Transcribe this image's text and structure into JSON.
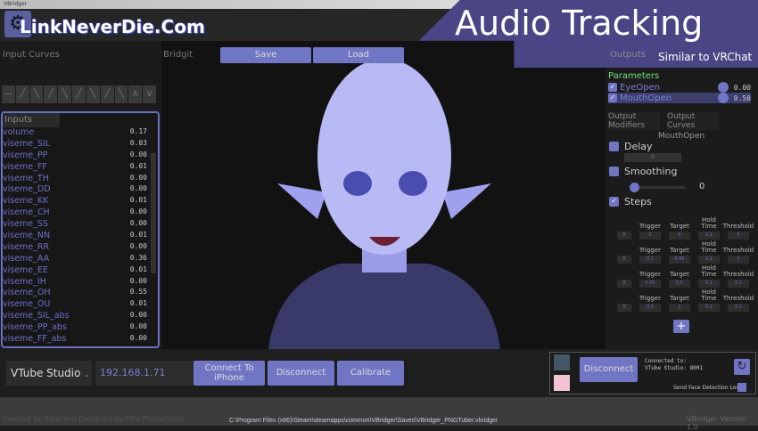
{
  "window": {
    "title": "VBridger"
  },
  "watermark": "LinkNeverDie.Com",
  "banner": {
    "title": "Audio Tracking",
    "subtitle": "Similar to VRChat"
  },
  "left": {
    "curves_label": "Input Curves",
    "inputs_label": "Inputs",
    "inputs": [
      [
        "volume",
        "0.17"
      ],
      [
        "viseme_SIL",
        "0.03"
      ],
      [
        "viseme_PP",
        "0.00"
      ],
      [
        "viseme_FF",
        "0.01"
      ],
      [
        "viseme_TH",
        "0.00"
      ],
      [
        "viseme_DD",
        "0.00"
      ],
      [
        "viseme_KK",
        "0.01"
      ],
      [
        "viseme_CH",
        "0.00"
      ],
      [
        "viseme_SS",
        "0.00"
      ],
      [
        "viseme_NN",
        "0.01"
      ],
      [
        "viseme_RR",
        "0.00"
      ],
      [
        "viseme_AA",
        "0.36"
      ],
      [
        "viseme_EE",
        "0.01"
      ],
      [
        "viseme_IH",
        "0.00"
      ],
      [
        "viseme_OH",
        "0.55"
      ],
      [
        "viseme_OU",
        "0.01"
      ],
      [
        "viseme_SIL_abs",
        "0.00"
      ],
      [
        "viseme_PP_abs",
        "0.00"
      ],
      [
        "viseme_FF_abs",
        "0.00"
      ]
    ]
  },
  "center": {
    "label": "Bridgit",
    "save": "Save",
    "load": "Load"
  },
  "right": {
    "outputs_label": "Outputs",
    "parameters_label": "Parameters",
    "parameters": [
      {
        "name": "EyeOpen",
        "value": "0.00",
        "checked": true
      },
      {
        "name": "MouthOpen",
        "value": "0.50",
        "checked": true
      }
    ],
    "tab_modifiers": "Output Modifiers",
    "tab_curves": "Output Curves",
    "selected": "MouthOpen",
    "delay_label": "Delay",
    "delay_value": "0",
    "smoothing_label": "Smoothing",
    "smoothing_value": "0",
    "steps_label": "Steps",
    "step_headers": [
      "Trigger",
      "Target",
      "Hold Time",
      "Threshold"
    ],
    "steps": [
      [
        "0",
        "0",
        "0.1",
        "0"
      ],
      [
        "0.1",
        "0.05",
        "0.1",
        "0"
      ],
      [
        "0.05",
        "0.5",
        "0.1",
        "0.1"
      ],
      [
        "0.5",
        "1",
        "0.1",
        "0.1"
      ]
    ],
    "remove_label": "X",
    "add_label": "+"
  },
  "bottom": {
    "source": "VTube Studio",
    "ip": "192.168.1.71",
    "connect": "Connect To iPhone",
    "disconnect": "Disconnect",
    "calibrate": "Calibrate",
    "vts_disconnect": "Disconnect",
    "connected_line1": "Connected to:",
    "connected_line2": "VTube Studio: 8001",
    "send_face": "Send Face Detection Loss"
  },
  "status": {
    "credit": "Created by Sarp and Designed by PiPu Productions",
    "path": "C:\\Program Files (x86)\\Steam\\steamapps\\common\\VBridger\\Saves\\VBridger_PNGTuber.vbridger",
    "version": "VBridger Version 1.0"
  },
  "colors": {
    "accent": "#7075c4",
    "banner": "#4a4685",
    "param_header": "#6fe07a"
  }
}
